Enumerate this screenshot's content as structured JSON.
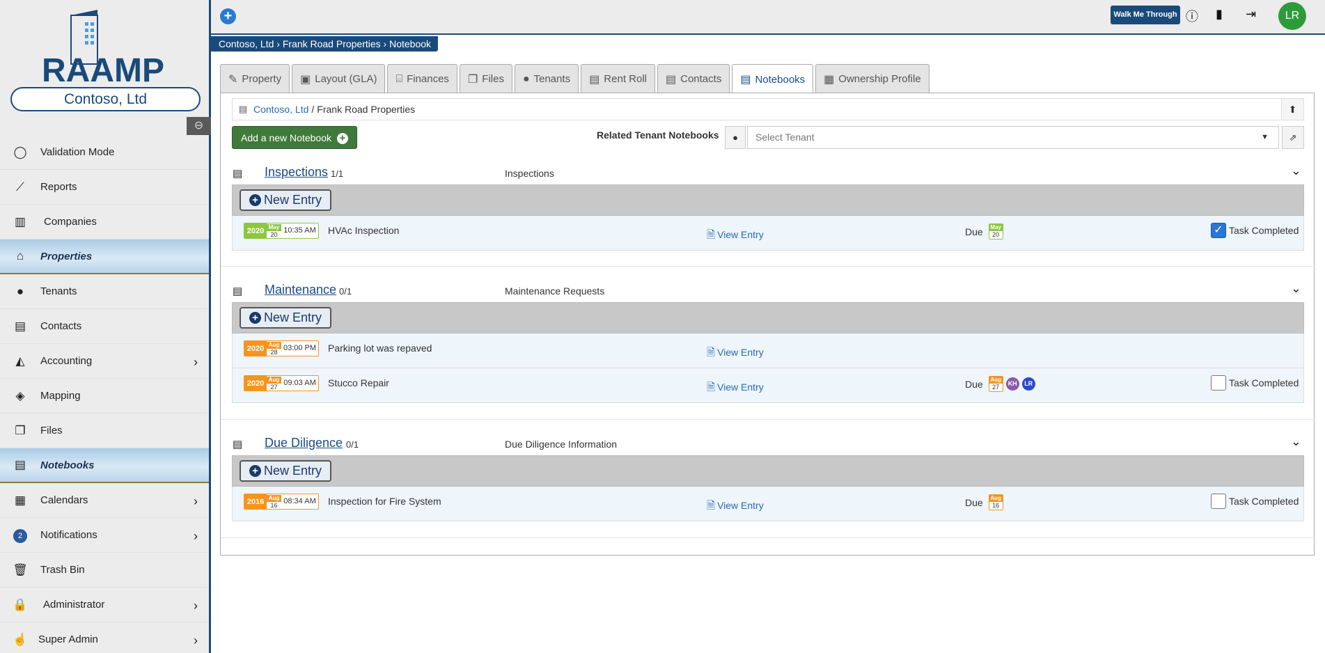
{
  "company": "Contoso, Ltd",
  "logo_text": "RAAMP",
  "sidebar": {
    "items": [
      {
        "label": "Validation Mode",
        "icon": "circle-icon"
      },
      {
        "label": "Reports",
        "icon": "chart-line-icon"
      },
      {
        "label": "Companies",
        "icon": "building-icon"
      },
      {
        "label": "Properties",
        "icon": "home-icon"
      },
      {
        "label": "Tenants",
        "icon": "user-icon"
      },
      {
        "label": "Contacts",
        "icon": "id-card-icon"
      },
      {
        "label": "Accounting",
        "icon": "area-chart-icon"
      },
      {
        "label": "Mapping",
        "icon": "map-icon"
      },
      {
        "label": "Files",
        "icon": "files-icon"
      },
      {
        "label": "Notebooks",
        "icon": "notebook-icon"
      },
      {
        "label": "Calendars",
        "icon": "calendar-icon"
      },
      {
        "label": "Notifications",
        "icon": "notification-icon",
        "badge": "2"
      },
      {
        "label": "Trash Bin",
        "icon": "trash-icon"
      },
      {
        "label": "Administrator",
        "icon": "lock-icon"
      },
      {
        "label": "Super Admin",
        "icon": "hand-icon"
      }
    ]
  },
  "topbar": {
    "walk_me_through": "Walk Me Through",
    "avatar_initials": "LR"
  },
  "breadcrumb": "Contoso, Ltd › Frank Road Properties › Notebook",
  "tabs": [
    "Property",
    "Layout (GLA)",
    "Finances",
    "Files",
    "Tenants",
    "Rent Roll",
    "Contacts",
    "Notebooks",
    "Ownership Profile"
  ],
  "path": {
    "link": "Contoso, Ltd",
    "sep": "/",
    "current": "Frank Road Properties"
  },
  "add_notebook": "Add a new Notebook",
  "related": {
    "label": "Related Tenant Notebooks",
    "placeholder": "Select Tenant"
  },
  "new_entry": "New Entry",
  "view_entry": "View Entry",
  "due_label": "Due",
  "task_completed": "Task Completed",
  "sections": [
    {
      "title": "Inspections",
      "count": "1/1",
      "desc": "Inspections",
      "entries": [
        {
          "year": "2020",
          "month": "May",
          "day": "20",
          "time": "10:35 AM",
          "title": "HVAc Inspection",
          "due_month": "May",
          "due_day": "20",
          "completed": true,
          "color": "#8dc63f"
        }
      ]
    },
    {
      "title": "Maintenance",
      "count": "0/1",
      "desc": "Maintenance Requests",
      "entries": [
        {
          "year": "2020",
          "month": "Aug",
          "day": "28",
          "time": "03:00 PM",
          "title": "Parking lot was repaved",
          "color": "#f7941d"
        },
        {
          "year": "2020",
          "month": "Aug",
          "day": "27",
          "time": "09:03 AM",
          "title": "Stucco Repair",
          "due_month": "Aug",
          "due_day": "27",
          "assignees": [
            "KH",
            "LR"
          ],
          "completed": false,
          "color": "#f7941d"
        }
      ]
    },
    {
      "title": "Due Diligence",
      "count": "0/1",
      "desc": "Due Diligence Information",
      "entries": [
        {
          "year": "2016",
          "month": "Aug",
          "day": "16",
          "time": "08:34 AM",
          "title": "Inspection for Fire System",
          "due_month": "Aug",
          "due_day": "16",
          "completed": false,
          "color": "#f7941d"
        }
      ]
    }
  ]
}
